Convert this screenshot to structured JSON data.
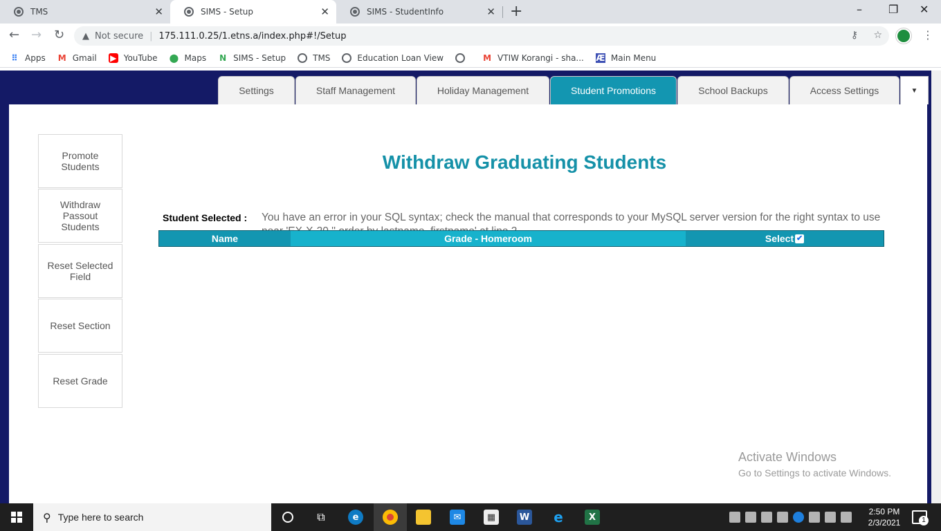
{
  "browser": {
    "tabs": [
      {
        "title": "TMS",
        "active": false
      },
      {
        "title": "SIMS - Setup",
        "active": true
      },
      {
        "title": "SIMS - StudentInfo",
        "active": false
      }
    ],
    "address": {
      "security": "Not secure",
      "url": "175.111.0.25/1.etns.a/index.php#!/Setup"
    },
    "bookmarks": [
      {
        "label": "Apps",
        "icon": "apps-grid-icon"
      },
      {
        "label": "Gmail",
        "icon": "gmail-icon"
      },
      {
        "label": "YouTube",
        "icon": "youtube-icon"
      },
      {
        "label": "Maps",
        "icon": "maps-pin-icon"
      },
      {
        "label": "SIMS - Setup",
        "icon": "sims-logo-icon"
      },
      {
        "label": "TMS",
        "icon": "globe-icon"
      },
      {
        "label": "Education Loan View",
        "icon": "globe-icon"
      },
      {
        "label": "",
        "icon": "globe-icon"
      },
      {
        "label": "VTIW Korangi - sha...",
        "icon": "gmail-icon"
      },
      {
        "label": "Main Menu",
        "icon": "main-menu-icon"
      }
    ]
  },
  "app": {
    "nav_tabs": [
      {
        "label": "Settings",
        "active": false
      },
      {
        "label": "Staff Management",
        "active": false
      },
      {
        "label": "Holiday Management",
        "active": false
      },
      {
        "label": "Student Promotions",
        "active": true
      },
      {
        "label": "School Backups",
        "active": false
      },
      {
        "label": "Access Settings",
        "active": false
      }
    ],
    "side_buttons": [
      {
        "label": "Promote Students"
      },
      {
        "label": "Withdraw Passout Students"
      },
      {
        "label": "Reset Selected Field"
      },
      {
        "label": "Reset Section"
      },
      {
        "label": "Reset Grade"
      }
    ],
    "title": "Withdraw Graduating Students",
    "student_selected_label": "Student Selected :",
    "sql_error": "You have an error in your SQL syntax; check the manual that corresponds to your MySQL server version for the right syntax to use near 'EX-X-20 '' order by lastname, firstname' at line 2",
    "table_headers": {
      "name": "Name",
      "grade": "Grade - Homeroom",
      "select": "Select"
    },
    "select_all_checked": true,
    "watermark": {
      "line1": "Activate Windows",
      "line2": "Go to Settings to activate Windows."
    },
    "colors": {
      "header_bg": "#141a66",
      "accent": "#1396b1",
      "title": "#1591a8"
    }
  },
  "taskbar": {
    "search_placeholder": "Type here to search",
    "time": "2:50 PM",
    "date": "2/3/2021",
    "notifications": "1"
  }
}
